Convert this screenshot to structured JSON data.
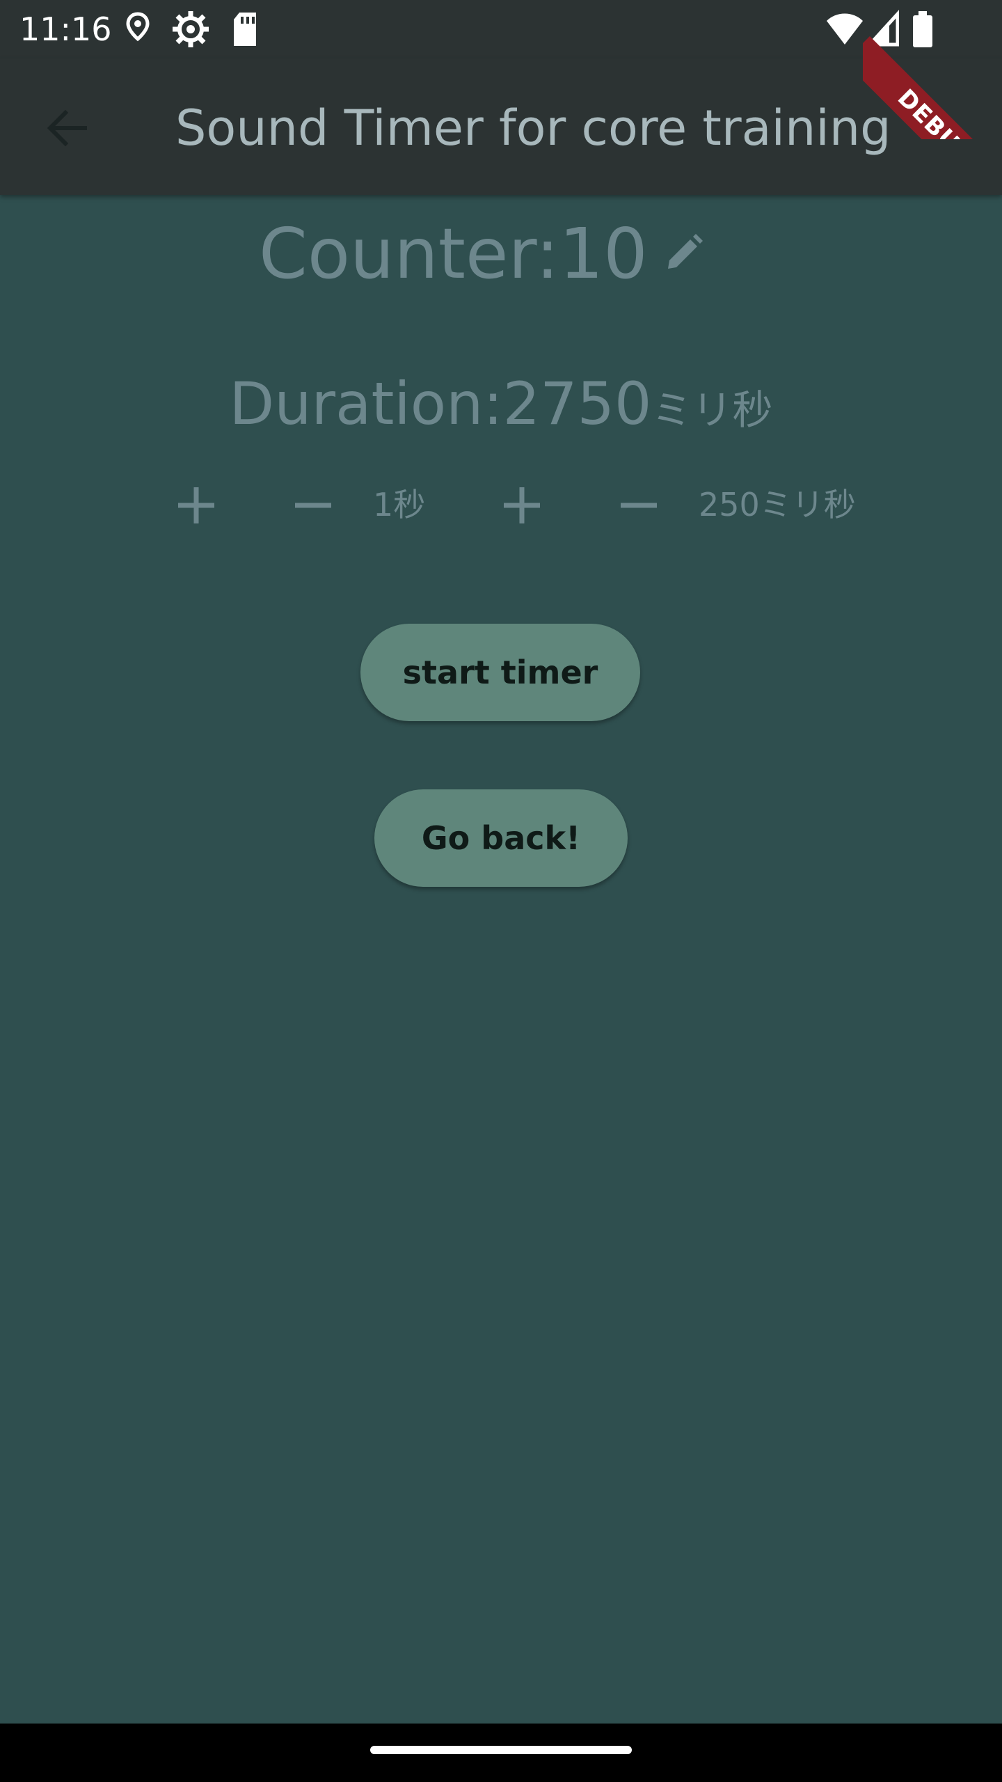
{
  "status_bar": {
    "time": "11:16",
    "icons": [
      "location-icon",
      "settings-icon",
      "sd-card-icon",
      "wifi-icon",
      "signal-icon",
      "battery-icon"
    ]
  },
  "app_bar": {
    "title": "Sound Timer for core training",
    "back_icon": "arrow-back-icon"
  },
  "debug_banner": "DEBUG",
  "counter": {
    "label": "Counter:10",
    "edit_icon": "edit-icon"
  },
  "duration": {
    "label": "Duration:2750",
    "unit": "ミリ秒"
  },
  "controls": {
    "seconds_label": "1秒",
    "millis_label": "250ミリ秒"
  },
  "buttons": {
    "start_timer": "start timer",
    "go_back": "Go back!"
  },
  "colors": {
    "background": "#2f4f4f",
    "app_bar": "#2c3333",
    "button": "#5f867b",
    "text_muted": "#6d878d",
    "debug_banner": "#8e1d24"
  }
}
